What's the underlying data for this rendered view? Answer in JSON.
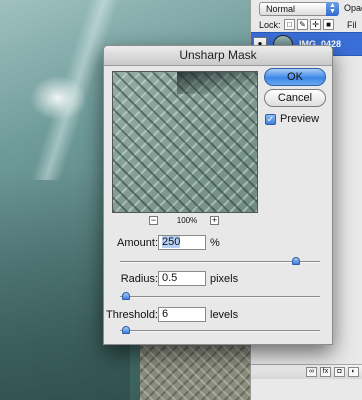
{
  "dialog": {
    "title": "Unsharp Mask",
    "ok_label": "OK",
    "cancel_label": "Cancel",
    "preview_label": "Preview",
    "preview_checked": true,
    "zoom": "100%",
    "zoom_out_symbol": "−",
    "zoom_in_symbol": "+",
    "amount": {
      "label": "Amount:",
      "value": "250",
      "unit": "%",
      "level": 0.88
    },
    "radius": {
      "label": "Radius:",
      "value": "0.5",
      "unit": "pixels",
      "level": 0.03
    },
    "threshold": {
      "label": "Threshold:",
      "value": "6",
      "unit": "levels",
      "level": 0.03
    }
  },
  "layers_panel": {
    "blend_mode": "Normal",
    "opacity_label": "Opacity",
    "lock_label": "Lock:",
    "fill_label": "Fil",
    "layer_name": "IMG_0428"
  },
  "colors": {
    "accent": "#3d87e6",
    "dialog_bg": "#e8e8e8"
  }
}
